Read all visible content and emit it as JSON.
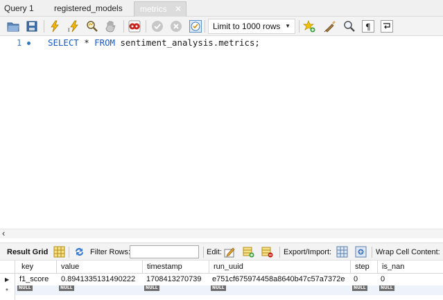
{
  "tabs": [
    {
      "label": "Query 1"
    },
    {
      "label": "registered_models"
    },
    {
      "label": "metrics",
      "active": true,
      "close": "✕"
    }
  ],
  "toolbar": {
    "limit_label": "Limit to 1000 rows",
    "icons": [
      "open-sql-folder-icon",
      "save-disk-icon",
      "execute-lightning-icon",
      "execute-current-lightning-icon",
      "explain-magnifier-icon",
      "stop-hand-icon",
      "toggle-stop-on-error-icon",
      "commit-check-icon",
      "rollback-cancel-icon",
      "auto-commit-icon",
      "add-snippet-star-icon",
      "beautify-broom-icon",
      "find-magnifier-icon",
      "invisible-chars-pilcrow-icon",
      "wrap-lines-icon"
    ]
  },
  "editor": {
    "line_number": "1",
    "code": {
      "kw_select": "SELECT",
      "star": " * ",
      "kw_from": "FROM",
      "target": " sentiment_analysis.metrics;"
    }
  },
  "result_toolbar": {
    "result_grid_label": "Result Grid",
    "filter_rows_label": "Filter Rows:",
    "filter_value": "",
    "edit_label": "Edit:",
    "export_label": "Export/Import:",
    "wrap_label": "Wrap Cell Content:"
  },
  "results": {
    "columns": [
      "key",
      "value",
      "timestamp",
      "run_uuid",
      "step",
      "is_nan"
    ],
    "rows": [
      [
        "f1_score",
        "0.8941335131490222",
        "1708413270739",
        "e751cf675974458a8640b47c57a7372e",
        "0",
        "0"
      ]
    ],
    "new_row_values": [
      "NULL",
      "NULL",
      "NULL",
      "NULL",
      "NULL",
      "NULL"
    ]
  },
  "colors": {
    "keyword": "#1458c7",
    "line_number": "#2d7cc2",
    "null_badge": "#6d6d6d"
  }
}
